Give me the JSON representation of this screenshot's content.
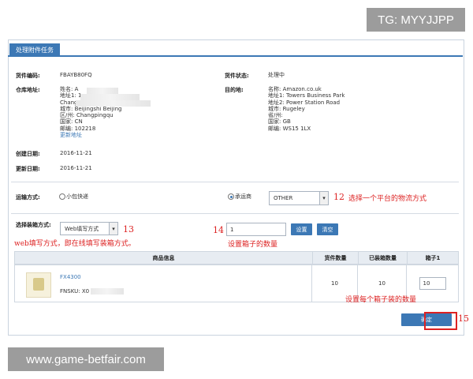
{
  "watermark_top": "TG: MYYJJPP",
  "watermark_bottom": "www.game-betfair.com",
  "tab_label": "处理附件任务",
  "shipment": {
    "id_label": "货件编码:",
    "id_value": "FBAYB80FQ",
    "status_label": "货件状态:",
    "status_value": "处理中",
    "warehouse_label": "仓库地址:",
    "warehouse_lines": [
      "姓名: A",
      "地址1: 1",
      "Chang",
      "城市: Beijingshi Beijing",
      "区/州: Changpingqu",
      "国家: CN",
      "邮编: 102218"
    ],
    "change_address_link": "更新地址",
    "destination_label": "目的地:",
    "destination_lines": [
      "名称: Amazon.co.uk",
      "地址1: Towers Business Park",
      "地址2: Power Station Road",
      "城市: Rugeley",
      "省/州:",
      "国家: GB",
      "邮编: WS15 1LX"
    ],
    "created_label": "创建日期:",
    "created_value": "2016-11-21",
    "updated_label": "更新日期:",
    "updated_value": "2016-11-21"
  },
  "shipping": {
    "method_label": "运输方式:",
    "option_small": "小包快递",
    "option_carrier": "承运商",
    "carrier_selected": "OTHER",
    "annotation_12_num": "12",
    "annotation_12_text": "选择一个平台的物流方式"
  },
  "packing": {
    "mode_label": "选择装箱方式:",
    "mode_selected": "Web填写方式",
    "annotation_13_num": "13",
    "annotation_13_text": "web填写方式，即在线填写装箱方式。",
    "annotation_14_num": "14",
    "box_count_value": "1",
    "set_button": "设置",
    "clear_button": "清空",
    "annotation_14_text": "设置箱子的数量"
  },
  "table": {
    "headers": [
      "商品信息",
      "货件数量",
      "已装箱数量",
      "箱子1"
    ],
    "rows": [
      {
        "sku_link": "FX4300",
        "fnsku": "FNSKU: X0",
        "shipped_qty": "10",
        "packed_qty": "10",
        "box1_qty": "10"
      }
    ],
    "annotation_box_text": "设置每个箱子装的数量",
    "submit_button": "确定",
    "annotation_15_num": "15"
  },
  "colors": {
    "accent": "#3c78b5",
    "annotation_red": "#dd2222",
    "watermark_gray": "#9c9c9c"
  }
}
